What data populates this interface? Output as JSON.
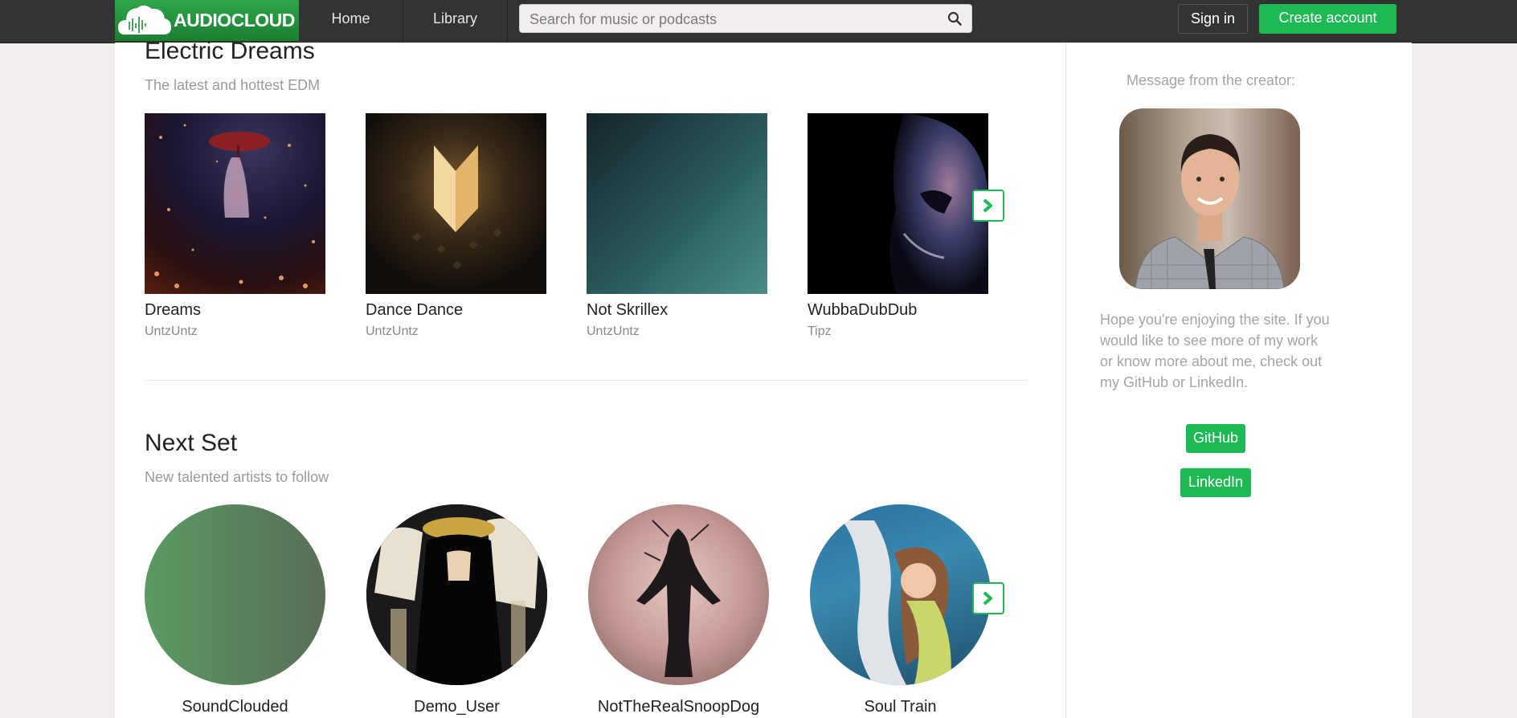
{
  "header": {
    "logo_text": "AUDIOCLOUD",
    "nav": {
      "home": "Home",
      "library": "Library"
    },
    "search_placeholder": "Search for music or podcasts",
    "signin": "Sign in",
    "create_account": "Create account"
  },
  "sections": [
    {
      "title": "Electric Dreams",
      "subtitle": "The latest and hottest EDM",
      "tracks": [
        {
          "title": "Dreams",
          "artist": "UntzUntz"
        },
        {
          "title": "Dance Dance",
          "artist": "UntzUntz"
        },
        {
          "title": "Not Skrillex",
          "artist": "UntzUntz"
        },
        {
          "title": "WubbaDubDub",
          "artist": "Tipz"
        }
      ]
    },
    {
      "title": "Next Set",
      "subtitle": "New talented artists to follow",
      "artists": [
        {
          "name": "SoundClouded"
        },
        {
          "name": "Demo_User"
        },
        {
          "name": "NotTheRealSnoopDog"
        },
        {
          "name": "Soul Train"
        }
      ]
    }
  ],
  "aside": {
    "heading": "Message from the creator:",
    "message": "Hope you're enjoying the site. If you would like to see more of my work or know more about me, check out my GitHub or LinkedIn.",
    "github": "GitHub",
    "linkedin": "LinkedIn"
  },
  "colors": {
    "accent": "#1db954",
    "topbar": "#333333",
    "background": "#f2eeee"
  },
  "icons": [
    "cloud-logo-icon",
    "search-icon",
    "chevron-right-icon"
  ]
}
